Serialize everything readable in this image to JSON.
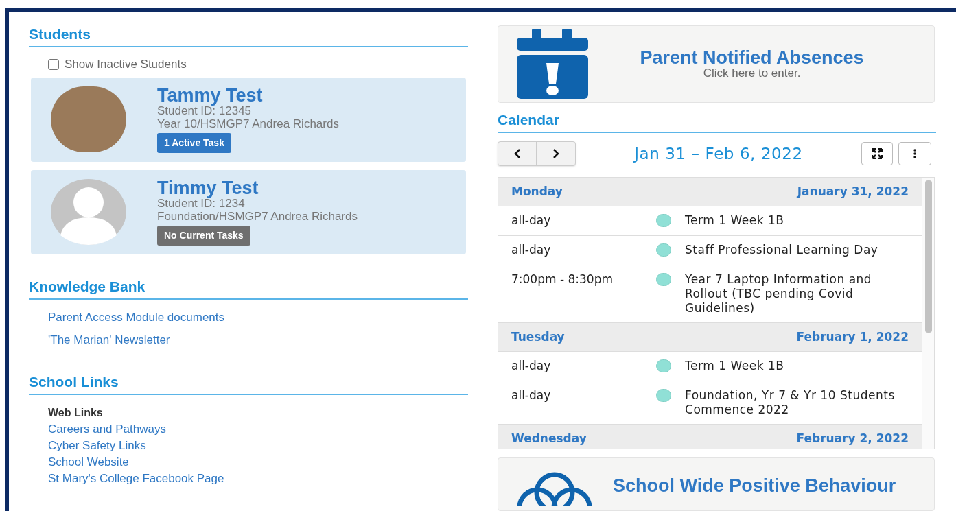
{
  "students": {
    "title": "Students",
    "show_inactive": {
      "label": "Show Inactive Students",
      "checked": false
    },
    "items": [
      {
        "name": "Tammy Test",
        "student_id": "Student ID: 12345",
        "class": "Year 10/HSMGP7 Andrea Richards",
        "avatar": {
          "kind": "photo"
        },
        "task": {
          "kind": "active",
          "label": "1 Active Task"
        }
      },
      {
        "name": "Timmy Test",
        "student_id": "Student ID: 1234",
        "class": "Foundation/HSMGP7 Andrea Richards",
        "avatar": {
          "kind": "silhouette"
        },
        "task": {
          "kind": "none",
          "label": "No Current Tasks"
        }
      }
    ]
  },
  "knowledge_bank": {
    "title": "Knowledge Bank",
    "links": [
      "Parent Access Module documents",
      "'The Marian' Newsletter"
    ]
  },
  "school_links": {
    "title": "School Links",
    "group": "Web Links",
    "links": [
      "Careers and Pathways",
      "Cyber Safety Links",
      "School Website",
      "St Mary's College Facebook Page"
    ]
  },
  "absences_banner": {
    "title": "Parent Notified Absences",
    "subtitle": "Click here to enter."
  },
  "calendar": {
    "title": "Calendar",
    "range": "Jan 31 – Feb 6, 2022",
    "days": [
      {
        "day": "Monday",
        "date": "January 31, 2022",
        "events": [
          {
            "time": "all-day",
            "title": "Term 1 Week 1B"
          },
          {
            "time": "all-day",
            "title": "Staff Professional Learning Day"
          },
          {
            "time": "7:00pm - 8:30pm",
            "title": "Year 7 Laptop Information and Rollout (TBC pending Covid Guidelines)"
          }
        ]
      },
      {
        "day": "Tuesday",
        "date": "February 1, 2022",
        "events": [
          {
            "time": "all-day",
            "title": "Term 1 Week 1B"
          },
          {
            "time": "all-day",
            "title": "Foundation, Yr 7 & Yr 10 Students Commence 2022"
          }
        ]
      },
      {
        "day": "Wednesday",
        "date": "February 2, 2022"
      }
    ]
  },
  "behaviour_banner": {
    "title": "School Wide Positive Behaviour"
  }
}
